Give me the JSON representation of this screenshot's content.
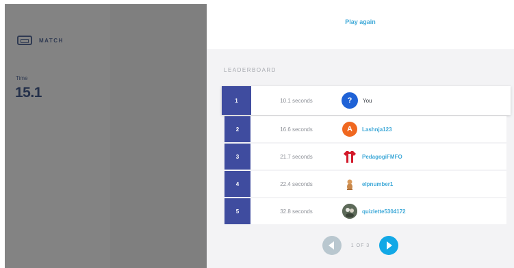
{
  "sidebar": {
    "mode_icon": "match-icon",
    "mode_label": "MATCH",
    "time_label": "Time",
    "time_value": "15.1"
  },
  "header": {
    "play_again_label": "Play again"
  },
  "leaderboard": {
    "title": "LEADERBOARD",
    "rows": [
      {
        "rank": "1",
        "seconds": "10.1 seconds",
        "avatar_text": "?",
        "avatar_icon": "question-avatar-icon",
        "name": "You",
        "is_current_user": true
      },
      {
        "rank": "2",
        "seconds": "16.6 seconds",
        "avatar_text": "A",
        "avatar_icon": "letter-a-avatar-icon",
        "name": "Lashnja123",
        "is_current_user": false
      },
      {
        "rank": "3",
        "seconds": "21.7 seconds",
        "avatar_text": "",
        "avatar_icon": "jersey-avatar-icon",
        "name": "PedagogiFMFO",
        "is_current_user": false
      },
      {
        "rank": "4",
        "seconds": "22.4 seconds",
        "avatar_text": "",
        "avatar_icon": "dog-avatar-icon",
        "name": "elpnumber1",
        "is_current_user": false
      },
      {
        "rank": "5",
        "seconds": "32.8 seconds",
        "avatar_text": "",
        "avatar_icon": "photo-avatar-icon",
        "name": "quizlette5304172",
        "is_current_user": false
      }
    ],
    "pagination": {
      "prev_icon": "chevron-left-icon",
      "next_icon": "chevron-right-icon",
      "text": "1 OF 3"
    }
  },
  "colors": {
    "rank_badge": "#3f4c9f",
    "link": "#3fa9d8",
    "next_button": "#12a8e6",
    "prev_button": "#b9c7cf"
  }
}
